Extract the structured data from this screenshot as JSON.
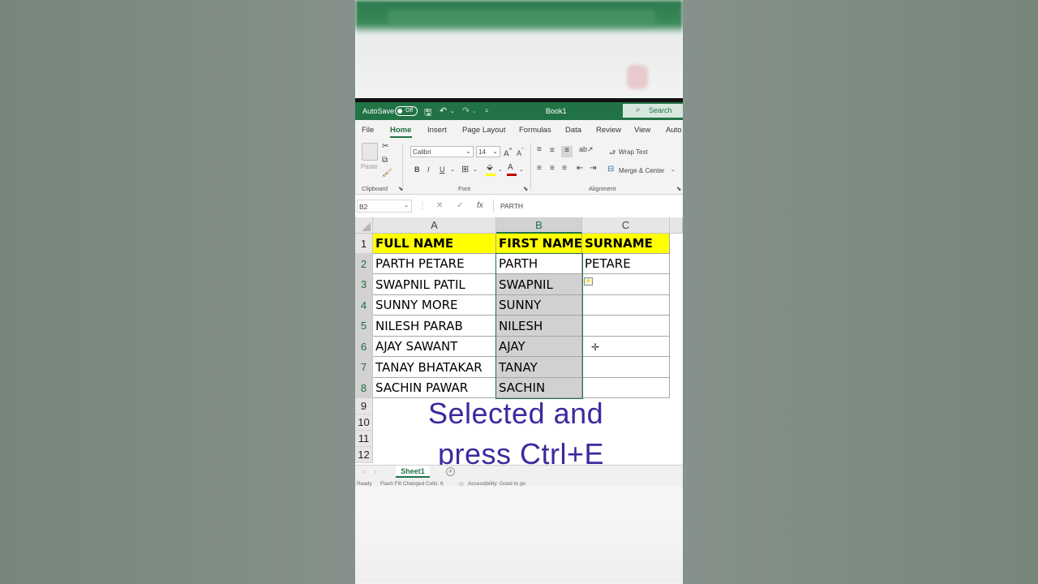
{
  "titlebar": {
    "autosave_label": "AutoSave",
    "toggle_state": "Off",
    "book_title": "Book1",
    "search_label": "Search"
  },
  "menu": [
    "File",
    "Home",
    "Insert",
    "Page Layout",
    "Formulas",
    "Data",
    "Review",
    "View",
    "Auto"
  ],
  "ribbon": {
    "paste_label": "Paste",
    "font_name": "Calibri",
    "font_size": "14",
    "bold": "B",
    "italic": "I",
    "underline": "U",
    "wrap_text": "Wrap Text",
    "merge_center": "Merge & Center",
    "groups": {
      "clipboard": "Clipboard",
      "font": "Font",
      "alignment": "Alignment"
    },
    "fill_color": "#ffff00",
    "font_color": "#c00000"
  },
  "formula_bar": {
    "name_box": "B2",
    "fx": "fx",
    "value": "PARTH"
  },
  "grid": {
    "columns": [
      "A",
      "B",
      "C"
    ],
    "rows": [
      "1",
      "2",
      "3",
      "4",
      "5",
      "6",
      "7",
      "8",
      "9",
      "10",
      "11",
      "12"
    ],
    "header": [
      "FULL NAME",
      "FIRST NAME",
      "SURNAME"
    ],
    "data": [
      [
        "PARTH PETARE",
        "PARTH",
        "PETARE"
      ],
      [
        "SWAPNIL PATIL",
        "SWAPNIL",
        ""
      ],
      [
        "SUNNY MORE",
        "SUNNY",
        ""
      ],
      [
        "NILESH PARAB",
        "NILESH",
        ""
      ],
      [
        "AJAY SAWANT",
        "AJAY",
        ""
      ],
      [
        "TANAY BHATAKAR",
        "TANAY",
        ""
      ],
      [
        "SACHIN PAWAR",
        "SACHIN",
        ""
      ]
    ],
    "header_color": "#ffff00"
  },
  "overlay": {
    "line1": "Selected and",
    "line2": "press Ctrl+E",
    "color": "#3a2a9e"
  },
  "tabs": {
    "sheet": "Sheet1"
  },
  "status": {
    "ready": "Ready",
    "flash_fill": "Flash Fill Changed Cells: 6",
    "accessibility": "Accessibility: Good to go"
  },
  "colors": {
    "excel_green": "#217346"
  }
}
